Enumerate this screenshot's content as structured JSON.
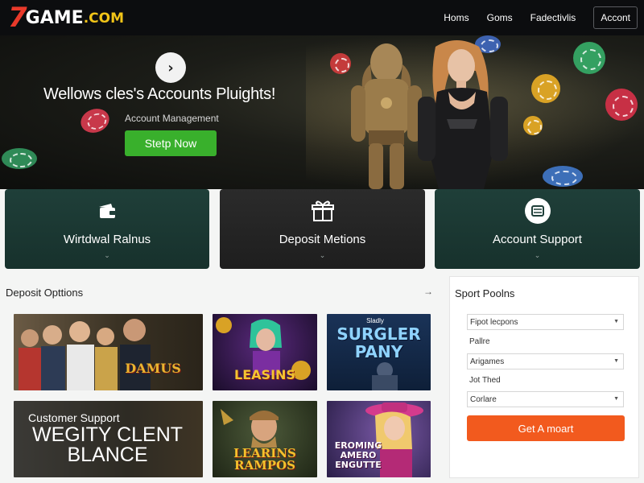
{
  "header": {
    "logo": {
      "seven": "7",
      "game": "GAME",
      "com": ".COM"
    },
    "nav": [
      {
        "label": "Homs"
      },
      {
        "label": "Goms"
      },
      {
        "label": "Fadectivlis"
      }
    ],
    "account_label": "Accont"
  },
  "hero": {
    "title": "Wellows cles's Accounts Pluights!",
    "subtitle": "Account Management",
    "cta_label": "Stetp Now",
    "play_icon": "chevron-right-icon"
  },
  "features": [
    {
      "label": "Wirtdwal Ralnus",
      "icon": "wallet-icon"
    },
    {
      "label": "Deposit Metions",
      "icon": "gift-icon"
    },
    {
      "label": "Account Support",
      "icon": "support-icon"
    }
  ],
  "deposit_section": {
    "title": "Deposit Opttions",
    "arrow": "→",
    "tiles": [
      {
        "caption": "DAMUS"
      },
      {
        "caption": "LEASINS"
      },
      {
        "caption_top": "Sladly",
        "caption": "SURGLER PANY"
      },
      {
        "caption_top": "Customer Support",
        "caption": "WEGITY CLENT BLANCE"
      },
      {
        "caption": "LEARINS RAMPOS"
      },
      {
        "caption": "EROMING AMERO ENGUTTE"
      }
    ]
  },
  "sidebar": {
    "title": "Sport Poolns",
    "fields": [
      {
        "type": "select",
        "value": "Fipot lecpons"
      },
      {
        "type": "label",
        "value": "Pallre"
      },
      {
        "type": "select",
        "value": "Arigames"
      },
      {
        "type": "label",
        "value": "Jot Thed"
      },
      {
        "type": "select",
        "value": "Corlare"
      }
    ],
    "button_label": "Get A moart"
  },
  "colors": {
    "header_bg": "#0c0d0f",
    "cta_green": "#39b02c",
    "card_teal": "#1f3f39",
    "card_dark": "#2b2b2b",
    "sidebar_button": "#f25a1e",
    "logo_red": "#e8392a",
    "logo_yellow": "#f1c418"
  }
}
